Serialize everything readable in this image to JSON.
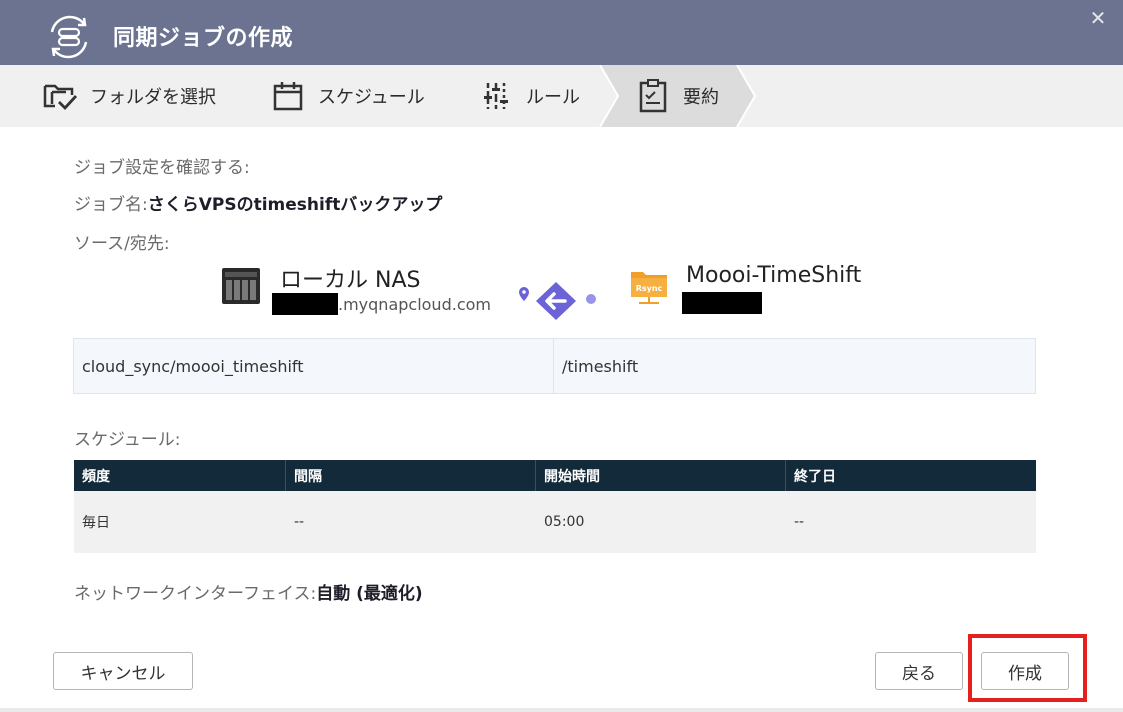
{
  "window": {
    "title": "同期ジョブの作成",
    "close_glyph": "✕"
  },
  "steps": [
    {
      "label": "フォルダを選択",
      "icon": "folder-check-icon"
    },
    {
      "label": "スケジュール",
      "icon": "calendar-icon"
    },
    {
      "label": "ルール",
      "icon": "sliders-icon"
    },
    {
      "label": "要約",
      "icon": "clipboard-checklist-icon",
      "active": true
    }
  ],
  "summary": {
    "heading": "ジョブ設定を確認する:",
    "job_name_label": "ジョブ名:",
    "job_name_value": "さくらVPSのtimeshiftバックアップ",
    "source_dest_label": "ソース/宛先:",
    "source": {
      "name": "ローカル NAS",
      "host_suffix": ".myqnapcloud.com",
      "icon": "nas-device-icon"
    },
    "destination": {
      "name": "Moooi-TimeShift",
      "icon": "rsync-server-icon"
    },
    "source_path": "cloud_sync/moooi_timeshift",
    "dest_path": "/timeshift",
    "schedule_label": "スケジュール:",
    "schedule_table": {
      "headers": [
        "頻度",
        "間隔",
        "開始時間",
        "終了日"
      ],
      "rows": [
        [
          "毎日",
          "--",
          "05:00",
          "--"
        ]
      ]
    },
    "network_label": "ネットワークインターフェイス:",
    "network_value": "自動 (最適化)"
  },
  "buttons": {
    "cancel": "キャンセル",
    "back": "戻る",
    "create": "作成"
  },
  "colors": {
    "titlebar": "#6b7391",
    "table_header": "#132a3a",
    "accent_purple": "#6b63d6",
    "rsync_orange": "#f0a02a",
    "highlight_red": "#e6201e"
  }
}
